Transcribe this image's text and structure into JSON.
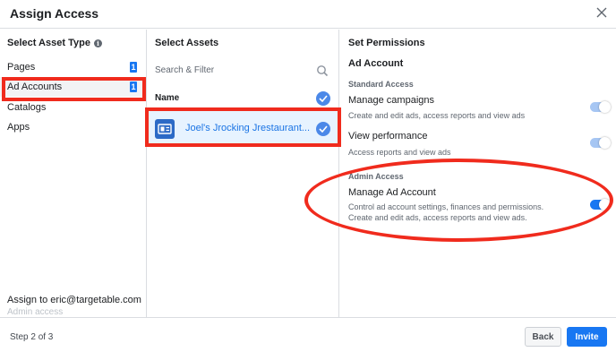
{
  "dialog": {
    "title": "Assign Access"
  },
  "asset_types": {
    "header": "Select Asset Type",
    "items": [
      {
        "label": "Pages",
        "badge": "1"
      },
      {
        "label": "Ad Accounts",
        "badge": "1"
      },
      {
        "label": "Catalogs"
      },
      {
        "label": "Apps"
      }
    ],
    "selected": "Ad Accounts",
    "assign_to": "Assign to eric@targetable.com",
    "assign_sub": "Admin access"
  },
  "assets": {
    "header": "Select Assets",
    "search_placeholder": "Search & Filter",
    "name_header": "Name",
    "items": [
      {
        "name": "Joel's Jrocking Jrestaurant...",
        "checked": true
      }
    ]
  },
  "permissions": {
    "header": "Set Permissions",
    "subtitle": "Ad Account",
    "standard": {
      "title": "Standard Access",
      "items": [
        {
          "title": "Manage campaigns",
          "desc": "Create and edit ads, access reports and view ads",
          "enabled": true
        },
        {
          "title": "View performance",
          "desc": "Access reports and view ads",
          "enabled": true
        }
      ]
    },
    "admin": {
      "title": "Admin Access",
      "items": [
        {
          "title": "Manage Ad Account",
          "desc_line1": "Control ad account settings, finances and permissions.",
          "desc_line2": "Create and edit ads, access reports and view ads.",
          "enabled": true
        }
      ]
    }
  },
  "footer": {
    "step": "Step 2 of 3",
    "back_label": "Back",
    "invite_label": "Invite"
  },
  "colors": {
    "accent": "#1877f2",
    "annotation_red": "#f02b1d",
    "selected_bg": "#e7f3ff"
  },
  "icons": [
    "info-icon",
    "close-icon",
    "search-icon",
    "checkmark-icon",
    "ad-account-icon"
  ]
}
